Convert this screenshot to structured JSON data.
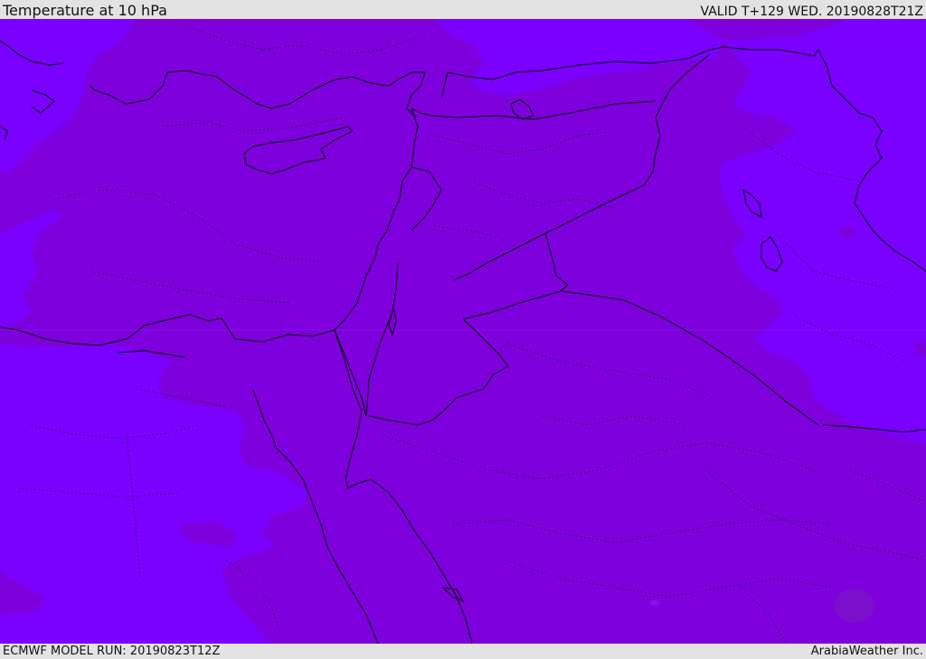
{
  "header": {
    "title": "Temperature at 10 hPa",
    "valid": "VALID T+129 WED. 20190828T21Z"
  },
  "footer": {
    "model_run": "ECMWF MODEL RUN: 20190823T12Z",
    "credit": "ArabiaWeather Inc."
  },
  "map": {
    "colors": {
      "warmer_band": "#7e00dc",
      "cooler_band": "#7a00ff",
      "border": "#000000"
    }
  }
}
